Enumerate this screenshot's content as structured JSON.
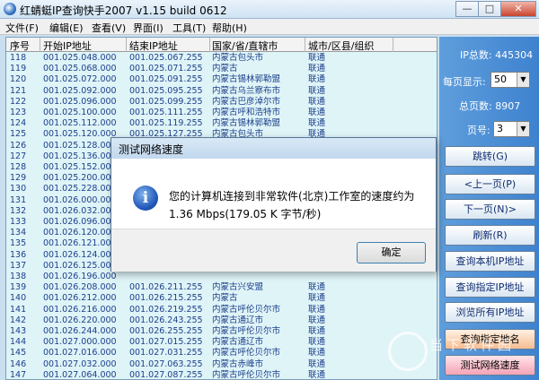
{
  "window": {
    "title": "红蜻蜓IP查询快手2007 v1.15 build 0612",
    "min_glyph": "—",
    "max_glyph": "□",
    "close_glyph": "✕"
  },
  "menu": [
    "文件(F)",
    "编辑(E)",
    "查看(V)",
    "界面(I)",
    "工具(T)",
    "帮助(H)"
  ],
  "table": {
    "headers": [
      "序号",
      "开始IP地址",
      "结束IP地址",
      "国家/省/直辖市",
      "城市/区县/组织"
    ],
    "rows": [
      [
        "118",
        "001.025.048.000",
        "001.025.067.255",
        "内蒙古包头市",
        "联通"
      ],
      [
        "119",
        "001.025.068.000",
        "001.025.071.255",
        "内蒙古",
        "联通"
      ],
      [
        "120",
        "001.025.072.000",
        "001.025.091.255",
        "内蒙古锡林郭勒盟",
        "联通"
      ],
      [
        "121",
        "001.025.092.000",
        "001.025.095.255",
        "内蒙古乌兰察布市",
        "联通"
      ],
      [
        "122",
        "001.025.096.000",
        "001.025.099.255",
        "内蒙古巴彦淖尔市",
        "联通"
      ],
      [
        "123",
        "001.025.100.000",
        "001.025.111.255",
        "内蒙古呼和浩特市",
        "联通"
      ],
      [
        "124",
        "001.025.112.000",
        "001.025.119.255",
        "内蒙古锡林郭勒盟",
        "联通"
      ],
      [
        "125",
        "001.025.120.000",
        "001.025.127.255",
        "内蒙古包头市",
        "联通"
      ],
      [
        "126",
        "001.025.128.000",
        "",
        "",
        ""
      ],
      [
        "127",
        "001.025.136.000",
        "",
        "",
        ""
      ],
      [
        "128",
        "001.025.152.000",
        "",
        "",
        ""
      ],
      [
        "129",
        "001.025.200.000",
        "",
        "",
        ""
      ],
      [
        "130",
        "001.025.228.000",
        "",
        "",
        ""
      ],
      [
        "131",
        "001.026.000.000",
        "",
        "",
        ""
      ],
      [
        "132",
        "001.026.032.000",
        "",
        "",
        ""
      ],
      [
        "133",
        "001.026.096.000",
        "",
        "",
        ""
      ],
      [
        "134",
        "001.026.120.000",
        "",
        "",
        ""
      ],
      [
        "135",
        "001.026.121.000",
        "",
        "",
        ""
      ],
      [
        "136",
        "001.026.124.000",
        "",
        "",
        ""
      ],
      [
        "137",
        "001.026.125.000",
        "",
        "",
        ""
      ],
      [
        "138",
        "001.026.196.000",
        "",
        "",
        ""
      ],
      [
        "139",
        "001.026.208.000",
        "001.026.211.255",
        "内蒙古兴安盟",
        "联通"
      ],
      [
        "140",
        "001.026.212.000",
        "001.026.215.255",
        "内蒙古",
        "联通"
      ],
      [
        "141",
        "001.026.216.000",
        "001.026.219.255",
        "内蒙古呼伦贝尔市",
        "联通"
      ],
      [
        "142",
        "001.026.220.000",
        "001.026.243.255",
        "内蒙古通辽市",
        "联通"
      ],
      [
        "143",
        "001.026.244.000",
        "001.026.255.255",
        "内蒙古呼伦贝尔市",
        "联通"
      ],
      [
        "144",
        "001.027.000.000",
        "001.027.015.255",
        "内蒙古通辽市",
        "联通"
      ],
      [
        "145",
        "001.027.016.000",
        "001.027.031.255",
        "内蒙古呼伦贝尔市",
        "联通"
      ],
      [
        "146",
        "001.027.032.000",
        "001.027.063.255",
        "内蒙古赤峰市",
        "联通"
      ],
      [
        "147",
        "001.027.064.000",
        "001.027.087.255",
        "内蒙古呼伦贝尔市",
        "联通"
      ]
    ]
  },
  "side": {
    "ip_total": "IP总数: 445304",
    "per_page_label": "每页显示:",
    "per_page_value": "50",
    "total_pages": "总页数: 8907",
    "page_label": "页号:",
    "page_value": "3",
    "dropdown_glyph": "▼",
    "buttons": [
      "跳转(G)",
      "<上一页(P)",
      "下一页(N)>",
      "刷新(R)",
      "查询本机IP地址",
      "查询指定IP地址",
      "浏览所有IP地址",
      "查询指定地名",
      "测试网络速度"
    ]
  },
  "dialog": {
    "title": "测试网络速度",
    "icon_glyph": "i",
    "message": "您的计算机连接到非常软件(北京)工作室的速度约为 1.36 Mbps(179.05 K 字节/秒)",
    "ok_label": "确定"
  },
  "watermark": {
    "text": "当下软件园"
  }
}
